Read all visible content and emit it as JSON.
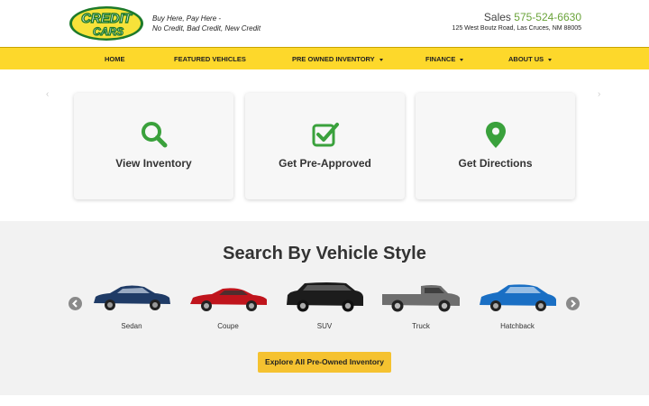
{
  "header": {
    "logo_text_top": "CREDIT",
    "logo_text_bottom": "CARS",
    "tagline_line1": "Buy Here, Pay Here -",
    "tagline_line2": "No Credit, Bad Credit, New Credit",
    "sales_label": "Sales",
    "phone": "575-524-6630",
    "address": "125 West Boutz Road, Las Cruces, NM 88005"
  },
  "nav": {
    "items": [
      {
        "label": "Home",
        "dropdown": false
      },
      {
        "label": "Featured Vehicles",
        "dropdown": false
      },
      {
        "label": "Pre Owned Inventory",
        "dropdown": true
      },
      {
        "label": "Finance",
        "dropdown": true
      },
      {
        "label": "About Us",
        "dropdown": true
      }
    ]
  },
  "hero": {
    "prev_arrow": "‹",
    "next_arrow": "›",
    "cards": [
      {
        "label": "View Inventory",
        "icon": "search-icon"
      },
      {
        "label": "Get Pre-Approved",
        "icon": "checkbox-icon"
      },
      {
        "label": "Get Directions",
        "icon": "map-pin-icon"
      }
    ]
  },
  "vehicle_styles": {
    "title": "Search By Vehicle Style",
    "items": [
      {
        "label": "Sedan",
        "color": "#1f3b66"
      },
      {
        "label": "Coupe",
        "color": "#c0141c"
      },
      {
        "label": "SUV",
        "color": "#1c1c1c"
      },
      {
        "label": "Truck",
        "color": "#6e6e6e"
      },
      {
        "label": "Hatchback",
        "color": "#1a6fc4"
      }
    ],
    "button_label": "Explore All Pre-Owned Inventory"
  },
  "colors": {
    "brand_yellow": "#fdd82b",
    "brand_green": "#3aa13c",
    "phone_green": "#6aa33a",
    "button_yellow": "#f5c230"
  }
}
